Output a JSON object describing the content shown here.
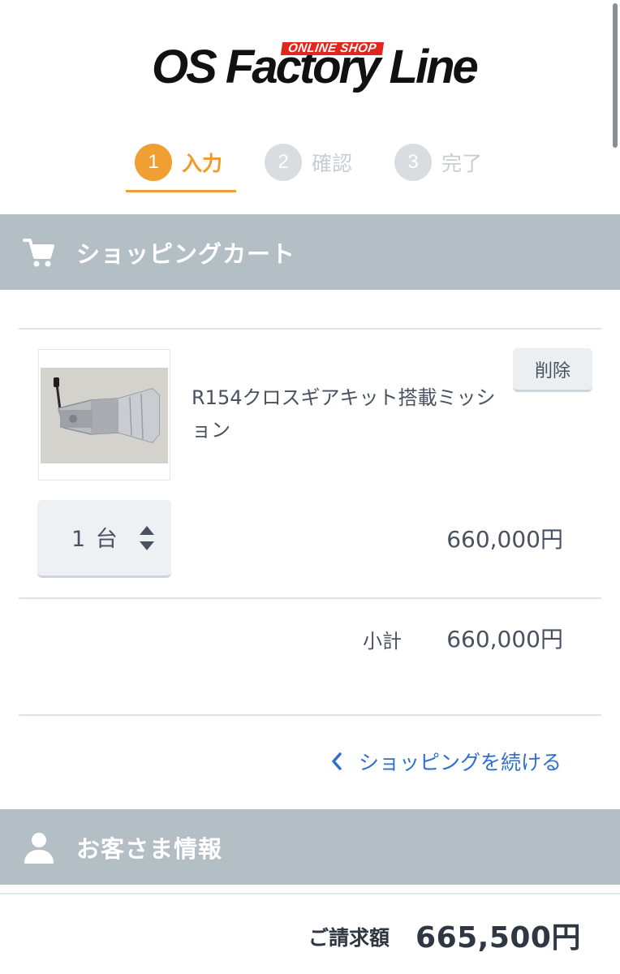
{
  "logo": {
    "text": "OS Factory Line",
    "badge": "ONLINE SHOP"
  },
  "steps": [
    {
      "num": "1",
      "label": "入力",
      "active": true
    },
    {
      "num": "2",
      "label": "確認",
      "active": false
    },
    {
      "num": "3",
      "label": "完了",
      "active": false
    }
  ],
  "cart": {
    "title": "ショッピングカート",
    "icon": "cart-icon",
    "item": {
      "name": "R154クロスギアキット搭載ミッション",
      "delete_label": "削除",
      "quantity": "1",
      "unit": "台",
      "price": "660,000円"
    },
    "subtotal_label": "小計",
    "subtotal_value": "660,000円",
    "continue_label": "ショッピングを続ける"
  },
  "customer": {
    "title": "お客さま情報",
    "icon": "user-icon"
  },
  "total": {
    "label": "ご請求額",
    "value": "665,500円"
  },
  "colors": {
    "accent": "#f0a033",
    "header": "#b3bec5",
    "link": "#2f6fd0"
  }
}
